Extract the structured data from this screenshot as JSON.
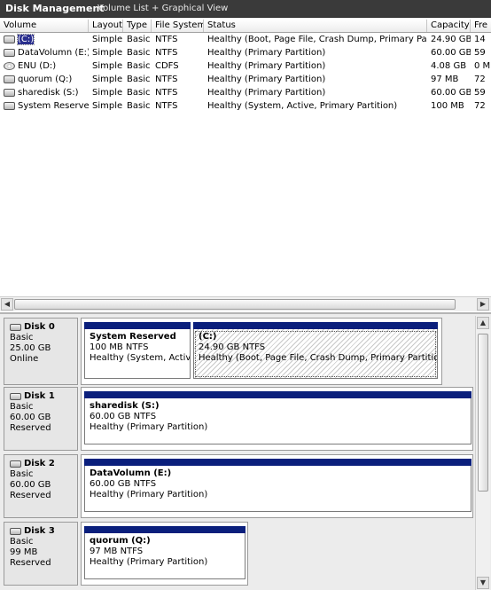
{
  "titlebar": {
    "app": "Disk Management",
    "view": "Volume List + Graphical View"
  },
  "columns": [
    "Volume",
    "Layout",
    "Type",
    "File System",
    "Status",
    "Capacity",
    "Fre"
  ],
  "volumes": [
    {
      "icon": "hard-disk-icon",
      "name": "(C:)",
      "layout": "Simple",
      "type": "Basic",
      "fs": "NTFS",
      "status": "Healthy (Boot, Page File, Crash Dump, Primary Partition)",
      "capacity": "24.90 GB",
      "free": "14",
      "selected": true
    },
    {
      "icon": "hard-disk-icon",
      "name": "DataVolumn (E:)",
      "layout": "Simple",
      "type": "Basic",
      "fs": "NTFS",
      "status": "Healthy (Primary Partition)",
      "capacity": "60.00 GB",
      "free": "59"
    },
    {
      "icon": "cd-drive-icon",
      "name": "ENU (D:)",
      "layout": "Simple",
      "type": "Basic",
      "fs": "CDFS",
      "status": "Healthy (Primary Partition)",
      "capacity": "4.08 GB",
      "free": "0 M"
    },
    {
      "icon": "hard-disk-icon",
      "name": "quorum (Q:)",
      "layout": "Simple",
      "type": "Basic",
      "fs": "NTFS",
      "status": "Healthy (Primary Partition)",
      "capacity": "97 MB",
      "free": "72"
    },
    {
      "icon": "hard-disk-icon",
      "name": "sharedisk (S:)",
      "layout": "Simple",
      "type": "Basic",
      "fs": "NTFS",
      "status": "Healthy (Primary Partition)",
      "capacity": "60.00 GB",
      "free": "59"
    },
    {
      "icon": "hard-disk-icon",
      "name": "System Reserved",
      "layout": "Simple",
      "type": "Basic",
      "fs": "NTFS",
      "status": "Healthy (System, Active, Primary Partition)",
      "capacity": "100 MB",
      "free": "72"
    }
  ],
  "disks": [
    {
      "name": "Disk 0",
      "type": "Basic",
      "size": "25.00 GB",
      "state": "Online",
      "partitions": [
        {
          "name": "System Reserved",
          "detail": "100 MB NTFS",
          "status": "Healthy (System, Active, P"
        },
        {
          "name": "(C:)",
          "detail": "24.90 GB NTFS",
          "status": "Healthy (Boot, Page File, Crash Dump, Primary Partition)"
        }
      ]
    },
    {
      "name": "Disk 1",
      "type": "Basic",
      "size": "60.00 GB",
      "state": "Reserved",
      "partitions": [
        {
          "name": "sharedisk  (S:)",
          "detail": "60.00 GB NTFS",
          "status": "Healthy (Primary Partition)"
        }
      ]
    },
    {
      "name": "Disk 2",
      "type": "Basic",
      "size": "60.00 GB",
      "state": "Reserved",
      "partitions": [
        {
          "name": "DataVolumn  (E:)",
          "detail": "60.00 GB NTFS",
          "status": "Healthy (Primary Partition)"
        }
      ]
    },
    {
      "name": "Disk 3",
      "type": "Basic",
      "size": "99 MB",
      "state": "Reserved",
      "partitions": [
        {
          "name": "quorum  (Q:)",
          "detail": "97 MB NTFS",
          "status": "Healthy (Primary Partition)"
        }
      ]
    }
  ],
  "colors": {
    "titlebar": "#3a3a3a",
    "partition_bar": "#0a1f7c",
    "selection": "#2a2f8e"
  }
}
